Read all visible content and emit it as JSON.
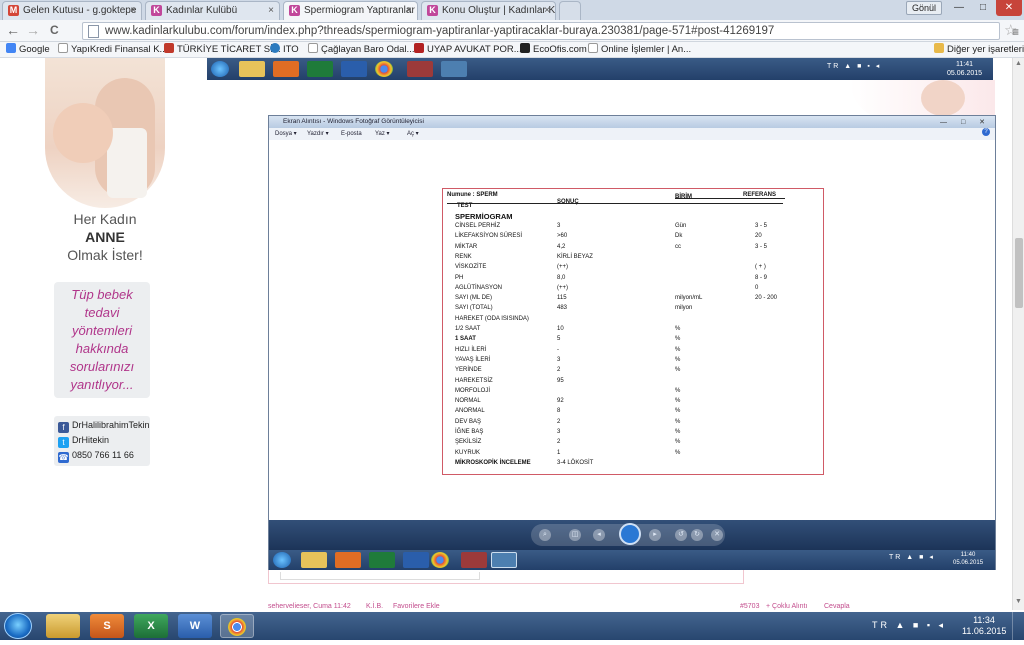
{
  "tabs": [
    {
      "label": "Gelen Kutusu - g.goktepe",
      "icon": "M",
      "color": "#d44638"
    },
    {
      "label": "Kadınlar Kulübü",
      "icon": "K",
      "color": "#c1479a"
    },
    {
      "label": "Spermiogram Yaptıranlar",
      "icon": "K",
      "color": "#c1479a"
    },
    {
      "label": "Konu Oluştur | Kadınlar K",
      "icon": "K",
      "color": "#c1479a"
    }
  ],
  "tab_close": "×",
  "user_button": "Gönül",
  "window_controls": {
    "minimize": "—",
    "maximize": "□",
    "close": "✕"
  },
  "nav": {
    "back": "←",
    "forward": "→",
    "reload": "C",
    "star": "☆",
    "menu": "≡"
  },
  "url": "www.kadinlarkulubu.com/forum/index.php?threads/spermiogram-yaptiranlar-yaptiracaklar-buraya.230381/page-571#post-41269197",
  "bookmarks": [
    {
      "label": "Google",
      "color": "#4285f4"
    },
    {
      "label": "YapıKredi Finansal K...",
      "color": "#1a4f9c"
    },
    {
      "label": "TÜRKİYE TİCARET Sİ...",
      "color": "#c0392b"
    },
    {
      "label": "ITO",
      "color": "#2c7bbf"
    },
    {
      "label": "Çağlayan Baro Odal...",
      "color": "#777"
    },
    {
      "label": "UYAP AVUKAT POR...",
      "color": "#b22222"
    },
    {
      "label": "EcoOfis.com",
      "color": "#333"
    },
    {
      "label": "Online İşlemler | An...",
      "color": "#5a7"
    }
  ],
  "other_bookmarks": "Diğer yer işaretleri",
  "sidebar": {
    "slogan_line1": "Her Kadın",
    "slogan_line2": "ANNE",
    "slogan_line3": "Olmak İster!",
    "ivf_lines": [
      "Tüp bebek",
      "tedavi",
      "yöntemleri",
      "hakkında",
      "sorularınızı",
      "yanıtlıyor..."
    ],
    "contacts": [
      {
        "label": "DrHalilibrahimTekin",
        "icon": "f",
        "color": "#3b5998"
      },
      {
        "label": "DrHitekin",
        "icon": "t",
        "color": "#1da1f2"
      },
      {
        "label": "0850 766 11 66",
        "icon": "☎",
        "color": "#2f6ad0"
      }
    ]
  },
  "inner_taskbar": {
    "lang": "TR",
    "time": "11:41",
    "date": "05.06.2015"
  },
  "photo_viewer": {
    "title": "Ekran Alıntısı - Windows Fotoğraf Görüntüleyicisi",
    "menu": [
      "Dosya ▾",
      "Yazdır ▾",
      "E-posta",
      "Yaz ▾",
      "Aç ▾"
    ],
    "help": "?",
    "controls": "— □ ✕",
    "taskbar": {
      "lang": "TR",
      "time": "11:40",
      "date": "05.06.2015"
    }
  },
  "report": {
    "header": {
      "name_label": "Numune :",
      "name_value": "SPERM",
      "birim": "BİRİM",
      "referans": "REFERANS",
      "test": "TEST",
      "sonuc": "SONUÇ"
    },
    "section": "SPERMİOGRAM",
    "rows": [
      {
        "test": "CİNSEL PERHİZ",
        "sonuc": "3",
        "birim": "Gün",
        "ref": "3 - 5"
      },
      {
        "test": "LİKEFAKSİYON SÜRESİ",
        "sonuc": ">60",
        "birim": "Dk",
        "ref": "20"
      },
      {
        "test": "MİKTAR",
        "sonuc": "4,2",
        "birim": "cc",
        "ref": "3 - 5"
      },
      {
        "test": "RENK",
        "sonuc": "KİRLİ BEYAZ",
        "birim": "",
        "ref": ""
      },
      {
        "test": "VİSKOZİTE",
        "sonuc": "(++)",
        "birim": "",
        "ref": "( + )"
      },
      {
        "test": "PH",
        "sonuc": "8,0",
        "birim": "",
        "ref": "8 - 9"
      },
      {
        "test": "AGLÜTİNASYON",
        "sonuc": "(++)",
        "birim": "",
        "ref": "0"
      },
      {
        "test": "SAYI (ML DE)",
        "sonuc": "115",
        "birim": "milyon/mL",
        "ref": "20 - 200"
      },
      {
        "test": "SAYI (TOTAL)",
        "sonuc": "483",
        "birim": "milyon",
        "ref": ""
      },
      {
        "test": "HAREKET (ODA ISISINDA)",
        "sonuc": "",
        "birim": "",
        "ref": ""
      },
      {
        "test": "1/2 SAAT",
        "sonuc": "10",
        "birim": "%",
        "ref": ""
      },
      {
        "test": "1 SAAT",
        "sonuc": "5",
        "birim": "%",
        "ref": ""
      },
      {
        "test": "HIZLI İLERİ",
        "sonuc": "-",
        "birim": "%",
        "ref": ""
      },
      {
        "test": "YAVAŞ İLERİ",
        "sonuc": "3",
        "birim": "%",
        "ref": ""
      },
      {
        "test": "YERİNDE",
        "sonuc": "2",
        "birim": "%",
        "ref": ""
      },
      {
        "test": "HAREKETSİZ",
        "sonuc": "95",
        "birim": "",
        "ref": ""
      },
      {
        "test": "MORFOLOJİ",
        "sonuc": "",
        "birim": "%",
        "ref": ""
      },
      {
        "test": "NORMAL",
        "sonuc": "92",
        "birim": "%",
        "ref": ""
      },
      {
        "test": "ANORMAL",
        "sonuc": "8",
        "birim": "%",
        "ref": ""
      },
      {
        "test": "DEV BAŞ",
        "sonuc": "2",
        "birim": "%",
        "ref": ""
      },
      {
        "test": "İĞNE BAŞ",
        "sonuc": "3",
        "birim": "%",
        "ref": ""
      },
      {
        "test": "ŞEKİLSİZ",
        "sonuc": "2",
        "birim": "%",
        "ref": ""
      },
      {
        "test": "KUYRUK",
        "sonuc": "1",
        "birim": "%",
        "ref": ""
      },
      {
        "test": "MİKROSKOPİK İNCELEME",
        "sonuc": "3-4 LÖKOSİT",
        "birim": "",
        "ref": ""
      }
    ]
  },
  "post_footer": {
    "author": "sehervelieser, Cuma 11:42",
    "kib": "K.İ.B.",
    "fav": "Favorilere Ekle",
    "number": "#5703",
    "multi": "+ Çoklu Alıntı",
    "reply": "Cevapla"
  },
  "taskbar": {
    "lang": "TR",
    "time": "11:34",
    "date": "11.06.2015"
  }
}
